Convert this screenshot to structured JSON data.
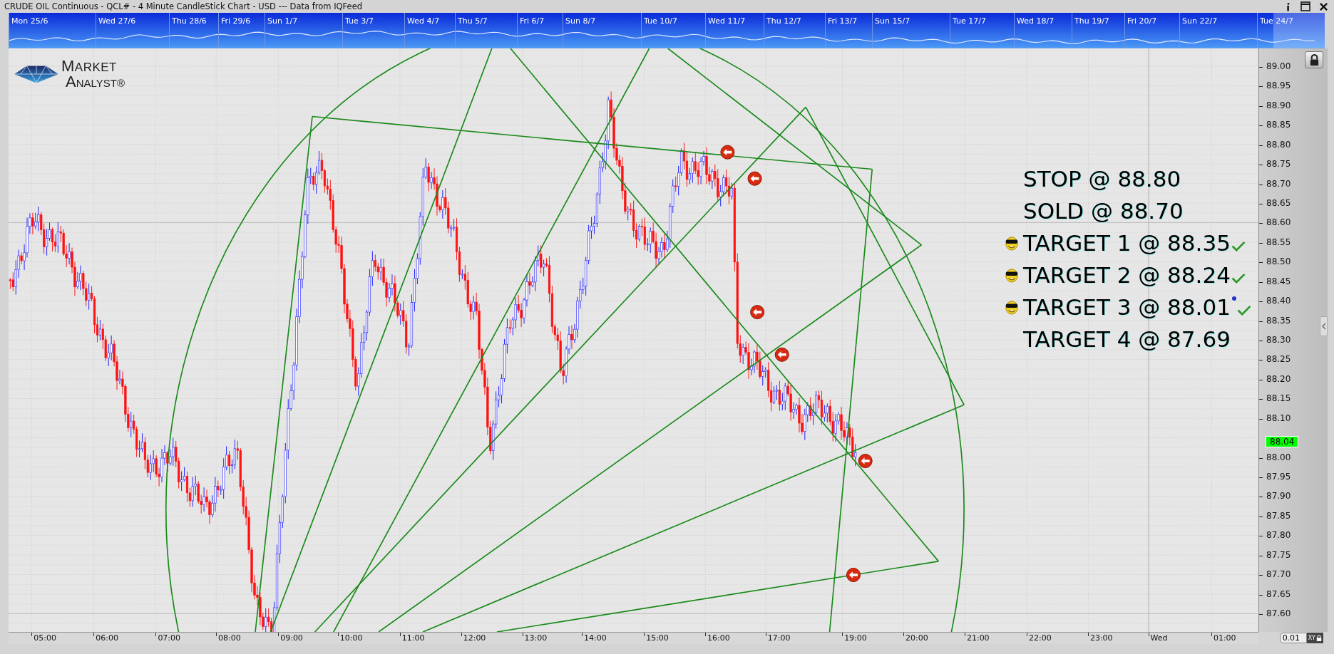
{
  "window": {
    "title": "CRUDE OIL Continuous - QCL# - 4 Minute CandleStick Chart - USD --- Data from IQFeed"
  },
  "navigator": {
    "dates": [
      "Mon 25/6",
      "Wed 27/6",
      "Thu 28/6",
      "Fri 29/6",
      "Sun 1/7",
      "Tue 3/7",
      "Wed 4/7",
      "Thu 5/7",
      "Fri 6/7",
      "Sun 8/7",
      "Tue 10/7",
      "Wed 11/7",
      "Thu 12/7",
      "Fri 13/7",
      "Sun 15/7",
      "Tue 17/7",
      "Wed 18/7",
      "Thu 19/7",
      "Fri 20/7",
      "Sun 22/7",
      "Tue 24/7"
    ]
  },
  "logo": {
    "line1": "MARKET",
    "line2": "ANALYST®"
  },
  "annotations": [
    {
      "text": "STOP @ 88.80",
      "smiley": false,
      "checked": false,
      "dot": false
    },
    {
      "text": "SOLD @ 88.70",
      "smiley": false,
      "checked": false,
      "dot": false
    },
    {
      "text": "TARGET 1 @ 88.35",
      "smiley": true,
      "checked": true,
      "dot": false
    },
    {
      "text": "TARGET 2 @ 88.24",
      "smiley": true,
      "checked": true,
      "dot": false
    },
    {
      "text": "TARGET 3 @ 88.01",
      "smiley": true,
      "checked": true,
      "dot": true
    },
    {
      "text": "TARGET 4 @ 87.69",
      "smiley": false,
      "checked": false,
      "dot": false
    }
  ],
  "price_axis": {
    "ticks": [
      "89.00",
      "88.95",
      "88.90",
      "88.85",
      "88.80",
      "88.75",
      "88.70",
      "88.65",
      "88.60",
      "88.55",
      "88.50",
      "88.45",
      "88.40",
      "88.35",
      "88.30",
      "88.25",
      "88.20",
      "88.15",
      "88.10",
      "88.00",
      "87.95",
      "87.90",
      "87.85",
      "87.80",
      "87.75",
      "87.70",
      "87.65",
      "87.60"
    ],
    "last_price": "88.04"
  },
  "time_axis": {
    "ticks": [
      "05:00",
      "06:00",
      "07:00",
      "08:00",
      "09:00",
      "10:00",
      "11:00",
      "12:00",
      "13:00",
      "14:00",
      "15:00",
      "16:00",
      "17:00",
      "19:00",
      "20:00",
      "21:00",
      "22:00",
      "23:00",
      "Wed",
      "01:00"
    ]
  },
  "scale_field": {
    "value": "0.01"
  },
  "xy_lock": {
    "label": "XY"
  }
}
